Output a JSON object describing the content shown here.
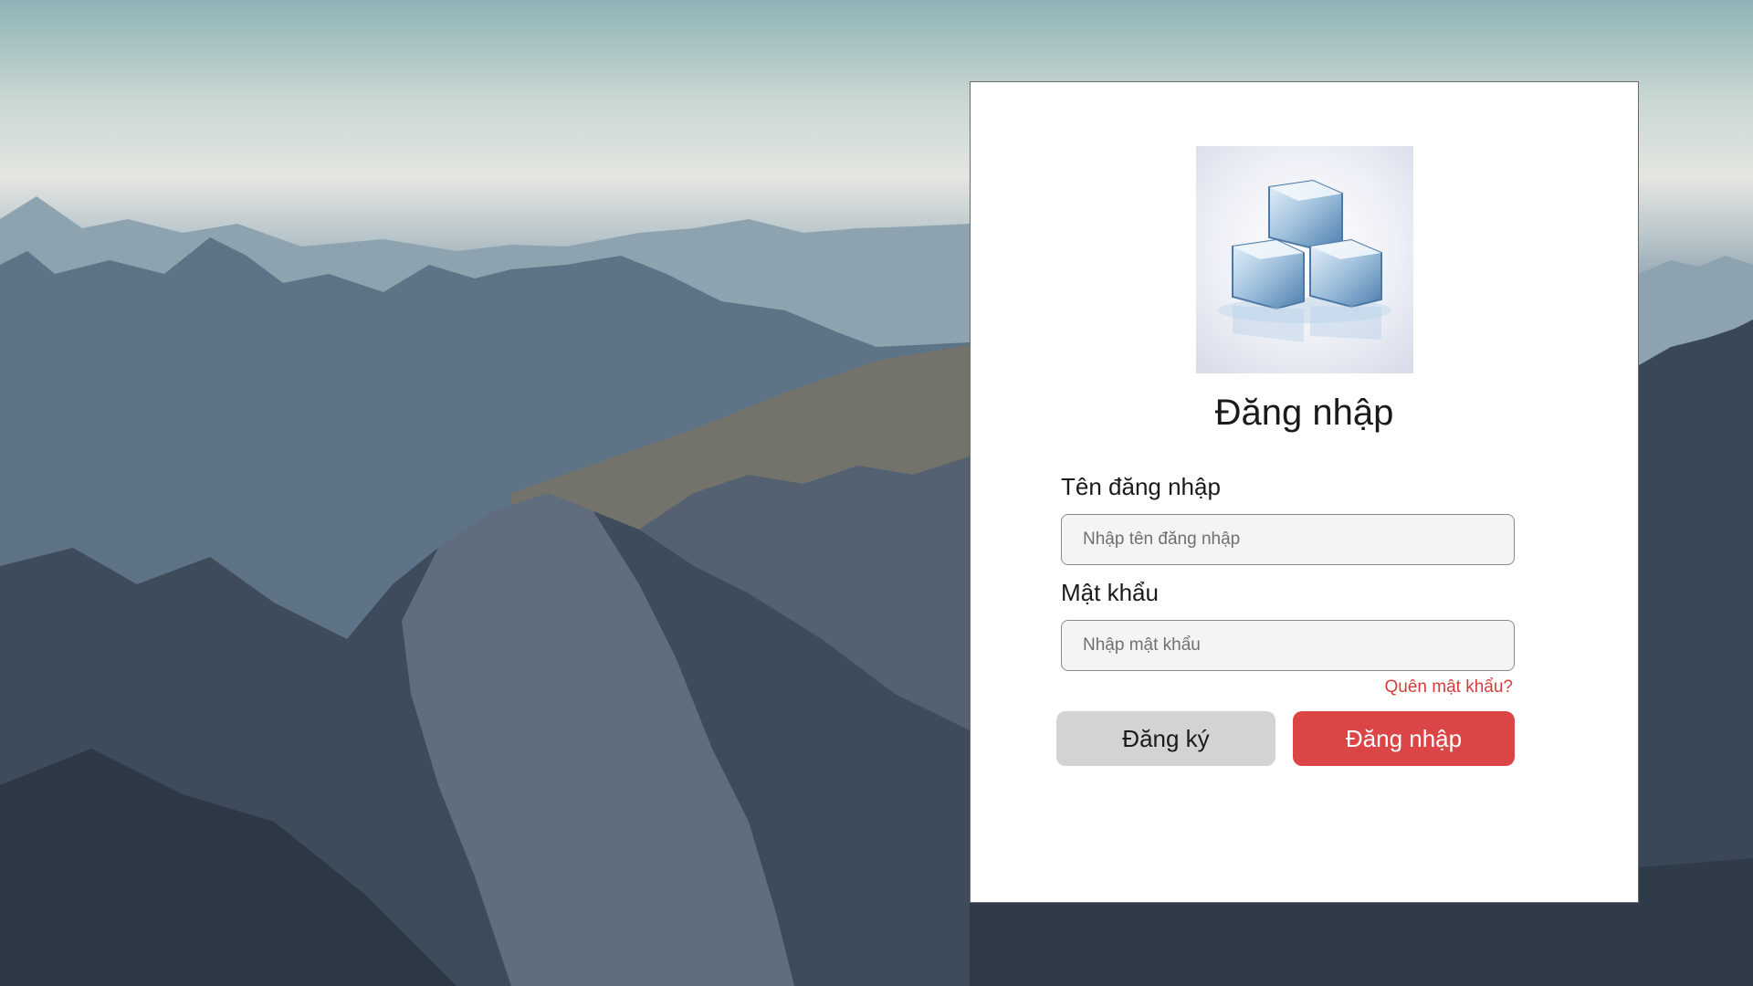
{
  "form": {
    "title": "Đăng nhập",
    "username_label": "Tên đăng nhập",
    "username_placeholder": "Nhập tên đăng nhập",
    "password_label": "Mật khẩu",
    "password_placeholder": "Nhập mật khẩu",
    "forgot_link": "Quên mật khẩu?",
    "register_button": "Đăng ký",
    "login_button": "Đăng nhập"
  },
  "colors": {
    "accent": "#db4545",
    "link": "#d63c3c",
    "secondary_button": "#d3d3d3"
  },
  "logo": {
    "icon": "ice-cubes-logo"
  }
}
